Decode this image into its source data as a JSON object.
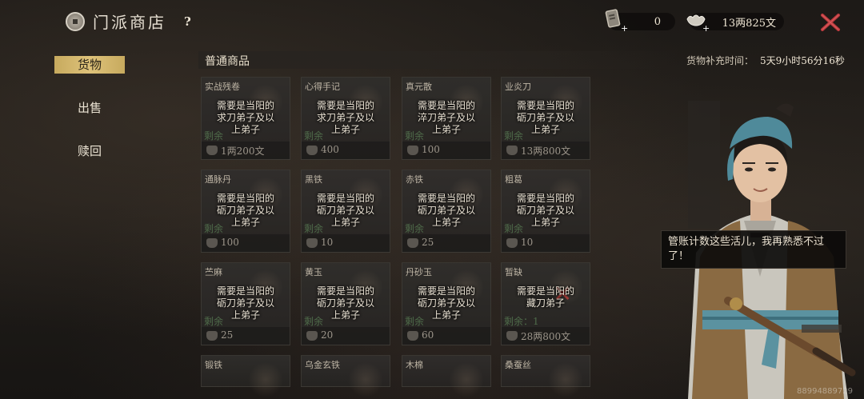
{
  "header": {
    "title": "门派商店",
    "help": "?",
    "tickets": "0",
    "silver": "13两825文"
  },
  "sidebar": {
    "items": [
      {
        "label": "货物",
        "active": true
      },
      {
        "label": "出售",
        "active": false
      },
      {
        "label": "赎回",
        "active": false
      }
    ]
  },
  "section": {
    "title": "普通商品",
    "refresh_label": "货物补充时间：",
    "refresh_time": "5天9小时56分16秒"
  },
  "items": [
    {
      "name": "实战残卷",
      "overlay": [
        "需要是当阳的",
        "求刀弟子及以",
        "上弟子"
      ],
      "stock": "剩余",
      "price": "1两200文",
      "currency": "silver"
    },
    {
      "name": "心得手记",
      "overlay": [
        "需要是当阳的",
        "求刀弟子及以",
        "上弟子"
      ],
      "stock": "剩余",
      "price": "400",
      "currency": "ticket"
    },
    {
      "name": "真元散",
      "overlay": [
        "需要是当阳的",
        "淬刀弟子及以",
        "上弟子"
      ],
      "stock": "剩余",
      "price": "100",
      "currency": "ticket"
    },
    {
      "name": "业炎刀",
      "overlay": [
        "需要是当阳的",
        "砺刀弟子及以",
        "上弟子"
      ],
      "stock": "剩余",
      "price": "13两800文",
      "currency": "silver"
    },
    {
      "name": "通脉丹",
      "overlay": [
        "需要是当阳的",
        "砺刀弟子及以",
        "上弟子"
      ],
      "stock": "剩余",
      "price": "100",
      "currency": "ticket"
    },
    {
      "name": "黑铁",
      "overlay": [
        "需要是当阳的",
        "砺刀弟子及以",
        "上弟子"
      ],
      "stock": "剩余",
      "price": "10",
      "currency": "ticket"
    },
    {
      "name": "赤铁",
      "overlay": [
        "需要是当阳的",
        "砺刀弟子及以",
        "上弟子"
      ],
      "stock": "剩余",
      "price": "25",
      "currency": "ticket"
    },
    {
      "name": "粗葛",
      "overlay": [
        "需要是当阳的",
        "砺刀弟子及以",
        "上弟子"
      ],
      "stock": "剩余",
      "price": "10",
      "currency": "ticket"
    },
    {
      "name": "苎麻",
      "overlay": [
        "需要是当阳的",
        "砺刀弟子及以",
        "上弟子"
      ],
      "stock": "剩余",
      "price": "25",
      "currency": "ticket"
    },
    {
      "name": "黄玉",
      "overlay": [
        "需要是当阳的",
        "砺刀弟子及以",
        "上弟子"
      ],
      "stock": "剩余",
      "price": "20",
      "currency": "ticket"
    },
    {
      "name": "丹砂玉",
      "overlay": [
        "需要是当阳的",
        "砺刀弟子及以",
        "上弟子"
      ],
      "stock": "剩余",
      "price": "60",
      "currency": "ticket"
    },
    {
      "name": "暂缺",
      "overlay": [
        "需要是当阳的",
        "藏刀弟子"
      ],
      "stock": "剩余：1",
      "price": "28两800文",
      "currency": "silver",
      "crossed": true
    },
    {
      "name": "锻铁",
      "overlay": [],
      "stock": "",
      "price": "",
      "currency": ""
    },
    {
      "name": "乌金玄铁",
      "overlay": [],
      "stock": "",
      "price": "",
      "currency": ""
    },
    {
      "name": "木棉",
      "overlay": [],
      "stock": "",
      "price": "",
      "currency": ""
    },
    {
      "name": "桑蚕丝",
      "overlay": [],
      "stock": "",
      "price": "",
      "currency": ""
    }
  ],
  "npc": {
    "speech": "管账计数这些活儿，我再熟悉不过了！"
  },
  "watermark": "88994889729",
  "colors": {
    "accent_gold": "#d8bc72",
    "close_red": "#b8383c",
    "stock_green": "#4f6b4a"
  }
}
